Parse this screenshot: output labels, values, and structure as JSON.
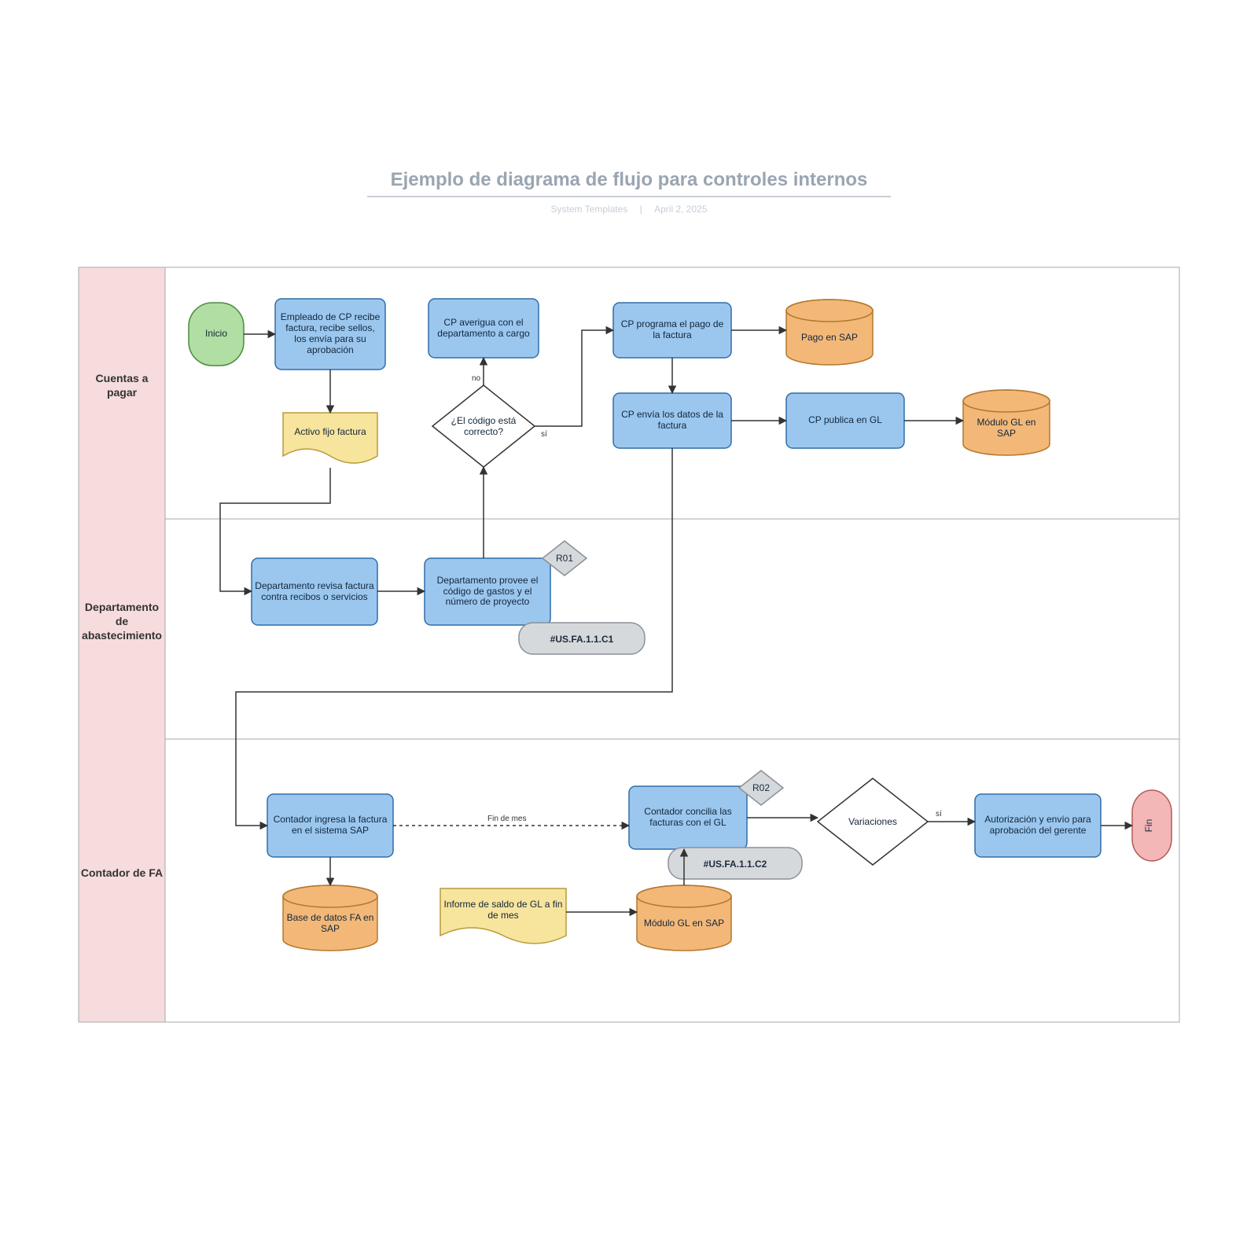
{
  "title": "Ejemplo de diagrama de flujo para controles internos",
  "meta": {
    "author": "System Templates",
    "date": "April 2, 2025"
  },
  "lanes": {
    "cp": "Cuentas a pagar",
    "da": "Departamento de abastecimiento",
    "fa": "Contador de FA"
  },
  "nodes": {
    "start": "Inicio",
    "n1": "Empleado de CP recibe factura, recibe sellos, los envía para su aprobación",
    "n2": "Activo fijo factura",
    "n3": "CP averigua con el departamento a cargo",
    "n4": "¿El código está correcto?",
    "n5": "CP programa el pago de la factura",
    "n6": "Pago en SAP",
    "n7": "CP envía los datos de la factura",
    "n8": "CP publica en GL",
    "n9": "Módulo GL en SAP",
    "n10": "Departamento revisa factura contra recibos o servicios",
    "n11": "Departamento provee el código de gastos y el número de proyecto",
    "r01": "R01",
    "c1": "#US.FA.1.1.C1",
    "n12": "Contador ingresa la factura en el sistema SAP",
    "n13": "Base de datos FA en SAP",
    "n14": "Informe de saldo de GL a fin de mes",
    "n15": "Módulo GL en SAP",
    "n16": "Contador concilia las facturas con el GL",
    "r02": "R02",
    "c2": "#US.FA.1.1.C2",
    "n17": "Variaciones",
    "n18": "Autorización y envío para aprobación del gerente",
    "end": "Fin",
    "edge_mid": "Fin de mes"
  },
  "labels": {
    "yes": "sí",
    "no": "no"
  }
}
